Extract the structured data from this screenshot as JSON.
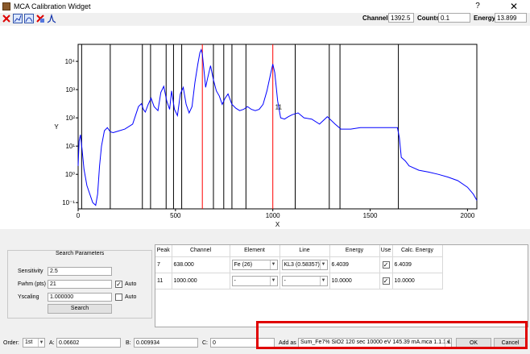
{
  "window": {
    "title": "MCA Calibration Widget",
    "help_glyph": "?",
    "close_glyph": "✕"
  },
  "toolbar": {
    "tools": [
      {
        "icon": "reset-zoom-icon"
      },
      {
        "icon": "log-scale-icon"
      },
      {
        "icon": "fit-icon"
      },
      {
        "icon": "clear-icon"
      },
      {
        "icon": "peak-icon"
      }
    ],
    "channel_label": "Channel:",
    "channel_value": "1392.5",
    "counts_label": "Counts:",
    "counts_value": "0.1",
    "energy_label": "Energy:",
    "energy_value": "13.899"
  },
  "chart_data": {
    "type": "line",
    "xlabel": "X",
    "ylabel": "Y",
    "xlim": [
      0,
      2048
    ],
    "ylim": [
      0.06,
      40000
    ],
    "yscale": "log",
    "xticks": [
      0,
      500,
      1000,
      1500,
      2000
    ],
    "yticks": [
      {
        "value": 0.1,
        "label": "10⁻¹"
      },
      {
        "value": 1,
        "label": "10⁰"
      },
      {
        "value": 10,
        "label": "10¹"
      },
      {
        "value": 100,
        "label": "10²"
      },
      {
        "value": 1000,
        "label": "10³"
      },
      {
        "value": 10000,
        "label": "10⁴"
      }
    ],
    "series_color": "#0000ff",
    "series": [
      {
        "x": [
          0,
          5,
          12,
          20,
          30,
          45,
          60,
          75,
          90,
          100,
          110,
          120,
          135,
          150,
          165,
          180,
          200,
          240,
          280,
          310,
          325,
          335,
          345,
          360,
          375,
          390,
          410,
          425,
          440,
          455,
          470,
          480,
          495,
          510,
          525,
          540,
          555,
          570,
          585,
          600,
          615,
          625,
          632,
          638,
          645,
          655,
          665,
          680,
          695,
          710,
          725,
          740,
          755,
          770,
          790,
          810,
          830,
          850,
          870,
          890,
          910,
          930,
          950,
          970,
          990,
          1000,
          1010,
          1025,
          1040,
          1060,
          1080,
          1100,
          1130,
          1160,
          1200,
          1240,
          1280,
          1320,
          1350,
          1400,
          1450,
          1500,
          1550,
          1600,
          1640,
          1650,
          1660,
          1680,
          1700,
          1750,
          1800,
          1850,
          1900,
          1950,
          2000,
          2030,
          2048
        ],
        "y": [
          2,
          15,
          25,
          8,
          1.5,
          0.4,
          0.2,
          0.1,
          0.08,
          0.2,
          2,
          10,
          35,
          45,
          32,
          30,
          33,
          40,
          60,
          250,
          320,
          200,
          160,
          300,
          500,
          250,
          180,
          800,
          1300,
          400,
          200,
          900,
          200,
          120,
          700,
          1200,
          300,
          150,
          250,
          1800,
          8000,
          20000,
          26000,
          18000,
          6000,
          1200,
          2500,
          7000,
          2200,
          900,
          600,
          300,
          500,
          700,
          300,
          220,
          180,
          200,
          250,
          200,
          180,
          200,
          300,
          900,
          4000,
          8000,
          4000,
          400,
          100,
          90,
          110,
          130,
          150,
          100,
          90,
          60,
          110,
          60,
          40,
          40,
          45,
          45,
          45,
          45,
          45,
          20,
          4,
          3,
          2,
          1.4,
          1.2,
          1.0,
          0.8,
          0.6,
          0.35,
          0.2,
          0.12
        ]
      }
    ],
    "peak_lines": [
      {
        "x": 18,
        "color": "#000000"
      },
      {
        "x": 165,
        "color": "#000000"
      },
      {
        "x": 330,
        "color": "#000000"
      },
      {
        "x": 372,
        "color": "#000000"
      },
      {
        "x": 452,
        "color": "#000000"
      },
      {
        "x": 490,
        "color": "#000000"
      },
      {
        "x": 532,
        "color": "#000000"
      },
      {
        "x": 638,
        "color": "#ff0000"
      },
      {
        "x": 695,
        "color": "#000000"
      },
      {
        "x": 748,
        "color": "#000000"
      },
      {
        "x": 790,
        "color": "#000000"
      },
      {
        "x": 862,
        "color": "#000000"
      },
      {
        "x": 1000,
        "color": "#ff0000"
      },
      {
        "x": 1115,
        "color": "#000000"
      },
      {
        "x": 1290,
        "color": "#000000"
      },
      {
        "x": 1345,
        "color": "#000000"
      },
      {
        "x": 1645,
        "color": "#000000"
      }
    ],
    "annotations": [
      {
        "text": "11",
        "x": 1012,
        "y": 200
      }
    ]
  },
  "search": {
    "title": "Search Parameters",
    "sensitivity_label": "Sensitivity",
    "sensitivity_value": "2.5",
    "fwhm_label": "Fwhm (pts)",
    "fwhm_value": "21",
    "yscaling_label": "Yscaling",
    "yscaling_value": "1.000000",
    "auto_label": "Auto",
    "auto2_label": "Auto",
    "auto1_mark": "✓",
    "auto2_mark": "",
    "search_button": "Search"
  },
  "table": {
    "headers": [
      "Peak",
      "Channel",
      "Element",
      "Line",
      "Energy",
      "Use",
      "Calc. Energy"
    ],
    "rows": [
      {
        "peak": "7",
        "channel": "638.000",
        "element": "Fe (26)",
        "line": "KL3 (0.58357)",
        "energy": "6.4039",
        "use": "✓",
        "calc": "6.4039"
      },
      {
        "peak": "11",
        "channel": "1000.000",
        "element": "-",
        "line": "-",
        "energy": "10.0000",
        "use": "✓",
        "calc": "10.0000"
      }
    ]
  },
  "footer": {
    "order_label": "Order:",
    "order_value": "1st",
    "a_label": "A:",
    "a_value": "0.06602",
    "b_label": "B:",
    "b_value": "0.009934",
    "c_label": "C:",
    "c_value": "0",
    "add_as_label": "Add as",
    "add_as_value": "Sum_Fe7% SiO2  120 sec 10000 eV 145.39 mA.mca 1.1.1.1",
    "ok_label": "OK",
    "cancel_label": "Cancel"
  }
}
